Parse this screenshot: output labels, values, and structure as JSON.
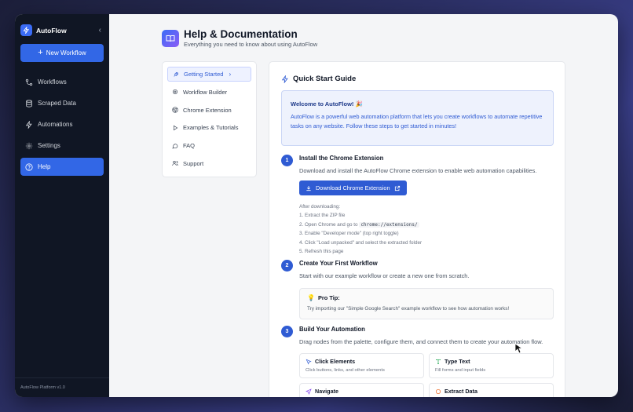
{
  "sidebar": {
    "brand": "AutoFlow",
    "new_workflow": "New Workflow",
    "items": [
      {
        "label": "Workflows",
        "icon": "workflow-icon"
      },
      {
        "label": "Scraped Data",
        "icon": "database-icon"
      },
      {
        "label": "Automations",
        "icon": "lightning-icon"
      },
      {
        "label": "Settings",
        "icon": "gear-icon"
      },
      {
        "label": "Help",
        "icon": "help-circle-icon"
      }
    ],
    "footer": "AutoFlow Platform v1.0"
  },
  "header": {
    "title": "Help & Documentation",
    "subtitle": "Everything you need to know about using AutoFlow"
  },
  "help_nav": [
    {
      "label": "Getting Started",
      "icon": "rocket-icon"
    },
    {
      "label": "Workflow Builder",
      "icon": "gear-icon"
    },
    {
      "label": "Chrome Extension",
      "icon": "chrome-icon"
    },
    {
      "label": "Examples & Tutorials",
      "icon": "play-icon"
    },
    {
      "label": "FAQ",
      "icon": "chat-icon"
    },
    {
      "label": "Support",
      "icon": "users-icon"
    }
  ],
  "content": {
    "title": "Quick Start Guide",
    "welcome_title": "Welcome to AutoFlow! 🎉",
    "welcome_body": "AutoFlow is a powerful web automation platform that lets you create workflows to automate repetitive tasks on any website. Follow these steps to get started in minutes!",
    "step1": {
      "num": "1",
      "title": "Install the Chrome Extension",
      "desc": "Download and install the AutoFlow Chrome extension to enable web automation capabilities.",
      "button": "Download Chrome Extension",
      "after_title": "After downloading:",
      "after_1": "1. Extract the ZIP file",
      "after_2_prefix": "2. Open Chrome and go to ",
      "after_2_code": "chrome://extensions/",
      "after_3": "3. Enable \"Developer mode\" (top right toggle)",
      "after_4": "4. Click \"Load unpacked\" and select the extracted folder",
      "after_5": "5. Refresh this page"
    },
    "step2": {
      "num": "2",
      "title": "Create Your First Workflow",
      "desc": "Start with our example workflow or create a new one from scratch.",
      "tip_title": "Pro Tip:",
      "tip_body": "Try importing our \"Simple Google Search\" example workflow to see how automation works!"
    },
    "step3": {
      "num": "3",
      "title": "Build Your Automation",
      "desc": "Drag nodes from the palette, configure them, and connect them to create your automation flow.",
      "cards": [
        {
          "title": "Click Elements",
          "desc": "Click buttons, links, and other elements"
        },
        {
          "title": "Type Text",
          "desc": "Fill forms and input fields"
        },
        {
          "title": "Navigate",
          "desc": ""
        },
        {
          "title": "Extract Data",
          "desc": ""
        }
      ]
    }
  }
}
